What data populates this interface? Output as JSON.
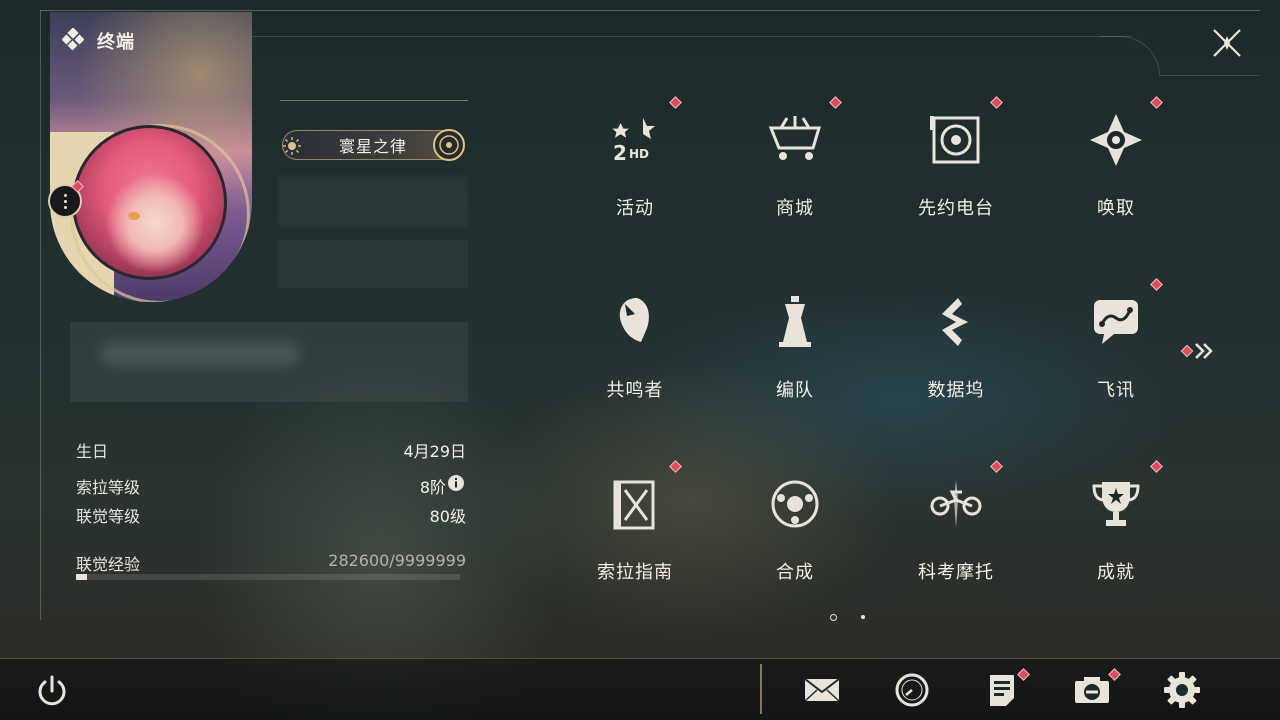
{
  "header": {
    "title": "终端"
  },
  "profile": {
    "title_plate": "寰星之律"
  },
  "stats": [
    {
      "label": "生日",
      "value": "4月29日"
    },
    {
      "label": "索拉等级",
      "value": "8阶"
    },
    {
      "label": "联觉等级",
      "value": "80级"
    }
  ],
  "experience": {
    "label": "联觉经验",
    "value_text": "282600/9999999",
    "progress_fraction": 0.028
  },
  "menu": [
    {
      "label": "活动",
      "icon": "activity-2hd-icon",
      "badge": true
    },
    {
      "label": "商城",
      "icon": "shop-cart-icon",
      "badge": true
    },
    {
      "label": "先约电台",
      "icon": "radio-pass-icon",
      "badge": true
    },
    {
      "label": "唤取",
      "icon": "convene-icon",
      "badge": true
    },
    {
      "label": "共鸣者",
      "icon": "resonator-head-icon",
      "badge": false
    },
    {
      "label": "编队",
      "icon": "team-chess-icon",
      "badge": false
    },
    {
      "label": "数据坞",
      "icon": "data-bank-icon",
      "badge": false
    },
    {
      "label": "飞讯",
      "icon": "message-chat-icon",
      "badge": true
    },
    {
      "label": "索拉指南",
      "icon": "guide-book-icon",
      "badge": true
    },
    {
      "label": "合成",
      "icon": "synthesis-icon",
      "badge": false
    },
    {
      "label": "科考摩托",
      "icon": "motorbike-icon",
      "badge": true
    },
    {
      "label": "成就",
      "icon": "trophy-icon",
      "badge": true
    }
  ],
  "footer": {
    "buttons": [
      {
        "name": "mail",
        "icon": "mail-icon",
        "badge": false
      },
      {
        "name": "time",
        "icon": "clock-icon",
        "badge": false
      },
      {
        "name": "notice",
        "icon": "notice-icon",
        "badge": true
      },
      {
        "name": "photo",
        "icon": "camera-icon",
        "badge": true
      },
      {
        "name": "settings",
        "icon": "gear-icon",
        "badge": false
      }
    ]
  },
  "colors": {
    "badge": "#e14b5a",
    "gold": "#d9c38a",
    "text": "#f4f0e4"
  }
}
